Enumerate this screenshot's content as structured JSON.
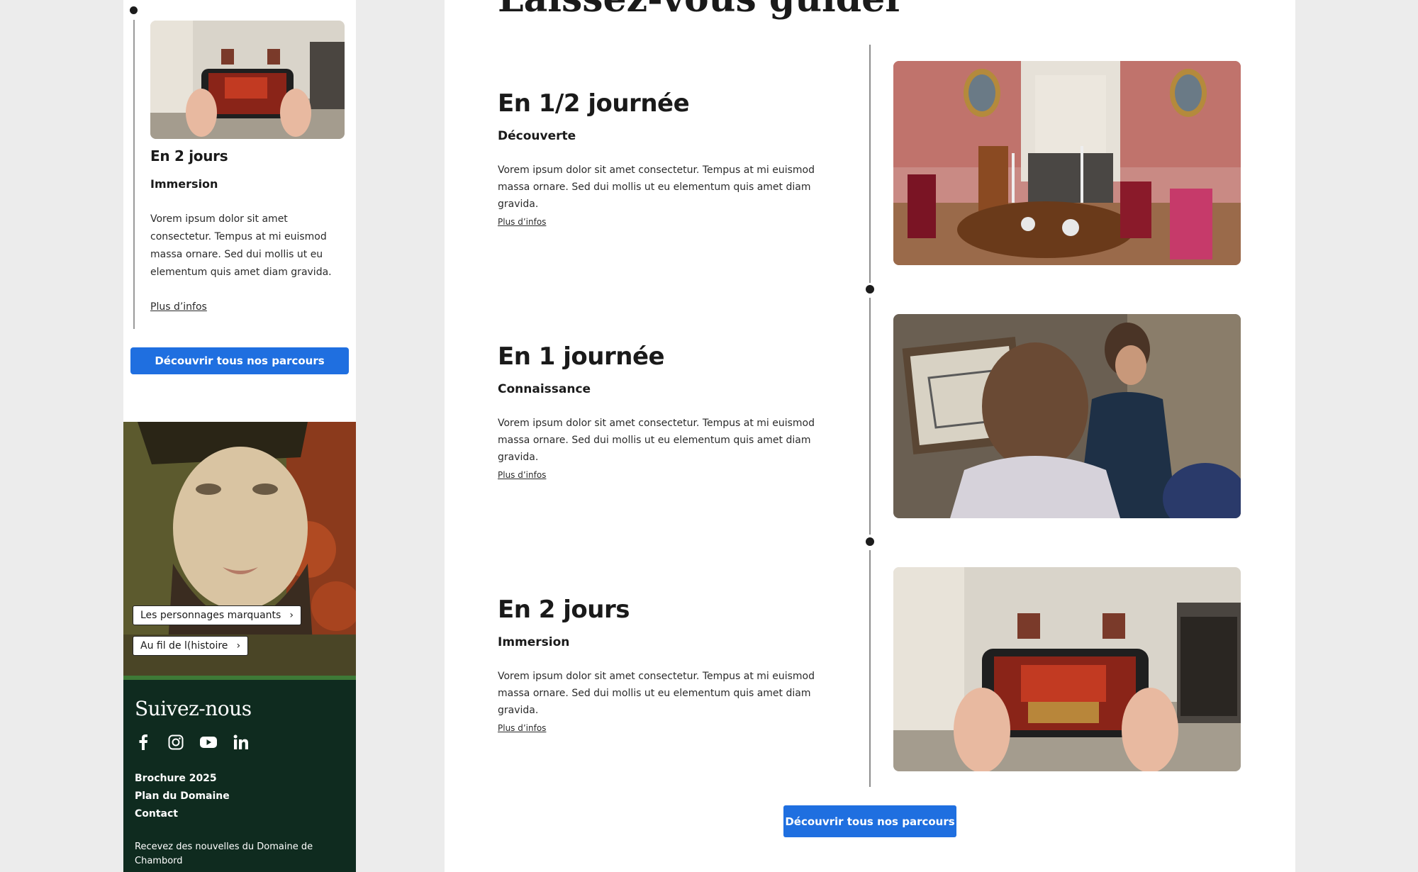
{
  "mobile": {
    "card": {
      "heading": "En 2 jours",
      "subtitle": "Immersion",
      "text": "Vorem ipsum dolor sit amet consectetur. Tempus at mi euismod massa ornare. Sed dui mollis ut eu elementum quis amet diam gravida.",
      "link": "Plus d’infos"
    },
    "cta": "Découvrir tous nos parcours",
    "chips": [
      "Les personnages marquants",
      "Au fil de l(histoire"
    ],
    "footer": {
      "follow": "Suivez-nous",
      "social_icons": [
        "facebook-icon",
        "instagram-icon",
        "youtube-icon",
        "linkedin-icon"
      ],
      "links": [
        "Brochure 2025",
        "Plan du Domaine",
        "Contact"
      ],
      "newsletter": "Recevez des nouvelles du Domaine de Chambord"
    }
  },
  "main": {
    "title": "Laissez-vous guider",
    "items": [
      {
        "heading": "En 1/2 journée",
        "subtitle": "Découverte",
        "text": "Vorem ipsum dolor sit amet consectetur. Tempus at mi euismod massa ornare. Sed dui mollis ut eu elementum quis amet diam gravida.",
        "link": "Plus d’infos"
      },
      {
        "heading": "En 1 journée",
        "subtitle": "Connaissance",
        "text": "Vorem ipsum dolor sit amet consectetur. Tempus at mi euismod massa ornare. Sed dui mollis ut eu elementum quis amet diam gravida.",
        "link": "Plus d’infos"
      },
      {
        "heading": "En 2 jours",
        "subtitle": "Immersion",
        "text": "Vorem ipsum dolor sit amet consectetur. Tempus at mi euismod massa ornare. Sed dui mollis ut eu elementum quis amet diam gravida.",
        "link": "Plus d’infos"
      }
    ],
    "cta": "Découvrir tous nos parcours"
  },
  "colors": {
    "accent": "#1f6fe0",
    "footer_bg": "#0f2b1f",
    "footer_band": "#3e7a37",
    "timeline": "#8e8e8e"
  }
}
